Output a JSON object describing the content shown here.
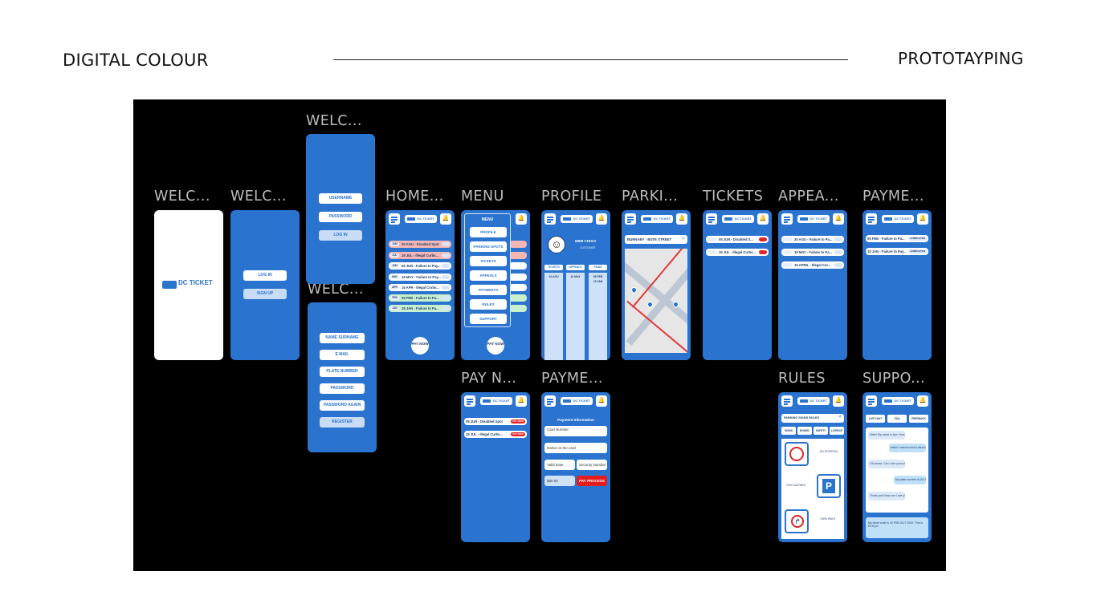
{
  "header": {
    "title": "DIGITAL COLOUR",
    "right_title": "PROTOTAYPING"
  },
  "frames": {
    "splash_label": "WELC...",
    "welcome_label": "WELC...",
    "login_label": "WELC...",
    "register_label": "WELC...",
    "home_label": "HOME...",
    "menu_label": "MENU",
    "profile_label": "PROFILE",
    "parking_label": "PARKI...",
    "tickets_label": "TICKETS",
    "appeals_label": "APPEA...",
    "payments_label": "PAYME...",
    "paynow_label": "PAY N...",
    "payment2_label": "PAYME...",
    "rules_label": "RULES",
    "support_label": "SUPPO..."
  },
  "splash": {
    "logo_text": "DC TICKET"
  },
  "welcome": {
    "login": "LOG IN",
    "signup": "SIGN UP"
  },
  "login": {
    "username": "USERNAME",
    "password": "PASSWORD",
    "login": "LOG IN"
  },
  "register": {
    "name": "NAME SURNAME",
    "email": "E MAIL",
    "plate": "PLATE NUMBER",
    "password": "PASSWORD",
    "password_again": "PASSWORD AGAIN",
    "register": "REGISTER"
  },
  "app": {
    "logo": "DC TICKET",
    "bell": "🔔"
  },
  "home": {
    "rows": [
      {
        "date": "JUN",
        "text": "20 AGU - Disabled Spot",
        "style": "red"
      },
      {
        "date": "JUL",
        "text": "15 JUL - Illegal Curbs...",
        "style": "red"
      },
      {
        "date": "JUN",
        "text": "05 JUN - Failure to Pay...",
        "style": ""
      },
      {
        "date": "MAY",
        "text": "19 MAY - Failure to Pay...",
        "style": ""
      },
      {
        "date": "APR",
        "text": "15 APR - Illegal Curbs...",
        "style": ""
      },
      {
        "date": "FEB",
        "text": "05 FEB - Failure to Pa...",
        "style": "green"
      },
      {
        "date": "JAN",
        "text": "15 JAN - Failure to Pa...",
        "style": "green"
      }
    ],
    "pay_now": "PAY NOW"
  },
  "menu": {
    "title": "MENU",
    "items": [
      "PROFILE",
      "PARKING SPOTS",
      "TICKETS",
      "APPEALS",
      "PAYMENTS",
      "RULES",
      "SUPPORT"
    ],
    "pay_now": "PAY NOW"
  },
  "profile": {
    "name": "MIMI CHIXO",
    "sub": "CUSTOMER",
    "columns": [
      "TICKETS",
      "APPEALS",
      "PAIDS"
    ],
    "values": [
      "02 AGU",
      "12 MAY",
      "05 FEB"
    ],
    "extra": "15 JAN"
  },
  "parking": {
    "search": "BURNABY - BUTE STREET"
  },
  "tickets": {
    "rows": [
      "05 JUN - Disabled S...",
      "15 JUL - Illegal Curbs..."
    ]
  },
  "appeals": {
    "rows": [
      "20 AGU - Failure to Pa...",
      "19 MAY - Failure to Pa...",
      "15 APRIL - Illegal Cur..."
    ]
  },
  "payments": {
    "rows": [
      "05 FEB - Failure to Pa...",
      "15 JAN - Failure to Pay..."
    ],
    "badge": "COMPLETED"
  },
  "paynow": {
    "rows": [
      "05 JUN - Disabled Spot",
      "15 JUL - Illegal Curbs..."
    ],
    "badge": "PAY NOW"
  },
  "payment_form": {
    "heading": "Payment Information",
    "card_number": "Card Number",
    "name_on_card": "Name on the card",
    "valid_date": "Valid Date",
    "security_number": "Security Number",
    "amount": "$50.00",
    "pay_process": "PAY PROCESS"
  },
  "rules": {
    "search": "PARKING SIGNS RULES",
    "tabs": [
      "SIGNS",
      "BOARD",
      "SAFETY",
      "LICENCE"
    ],
    "labels": [
      "NO STOPPING",
      "YOU CAN PARK",
      "TURN RIGHT"
    ]
  },
  "support": {
    "tabs": [
      "LIVE CHAT",
      "FAQ",
      "FEEDBACK"
    ],
    "messages": [
      "Hello! My name is Ayo. How can I help you today?",
      "Hello! I need to know about my parking ticket issue",
      "Of course. Can I see your plate number please?",
      "My plate number is DK 9456",
      "Thank you! Now can I see your ticket code please?",
      "My ticket code is 16 FEB 2017 2000. This is 8:16 pm"
    ]
  }
}
